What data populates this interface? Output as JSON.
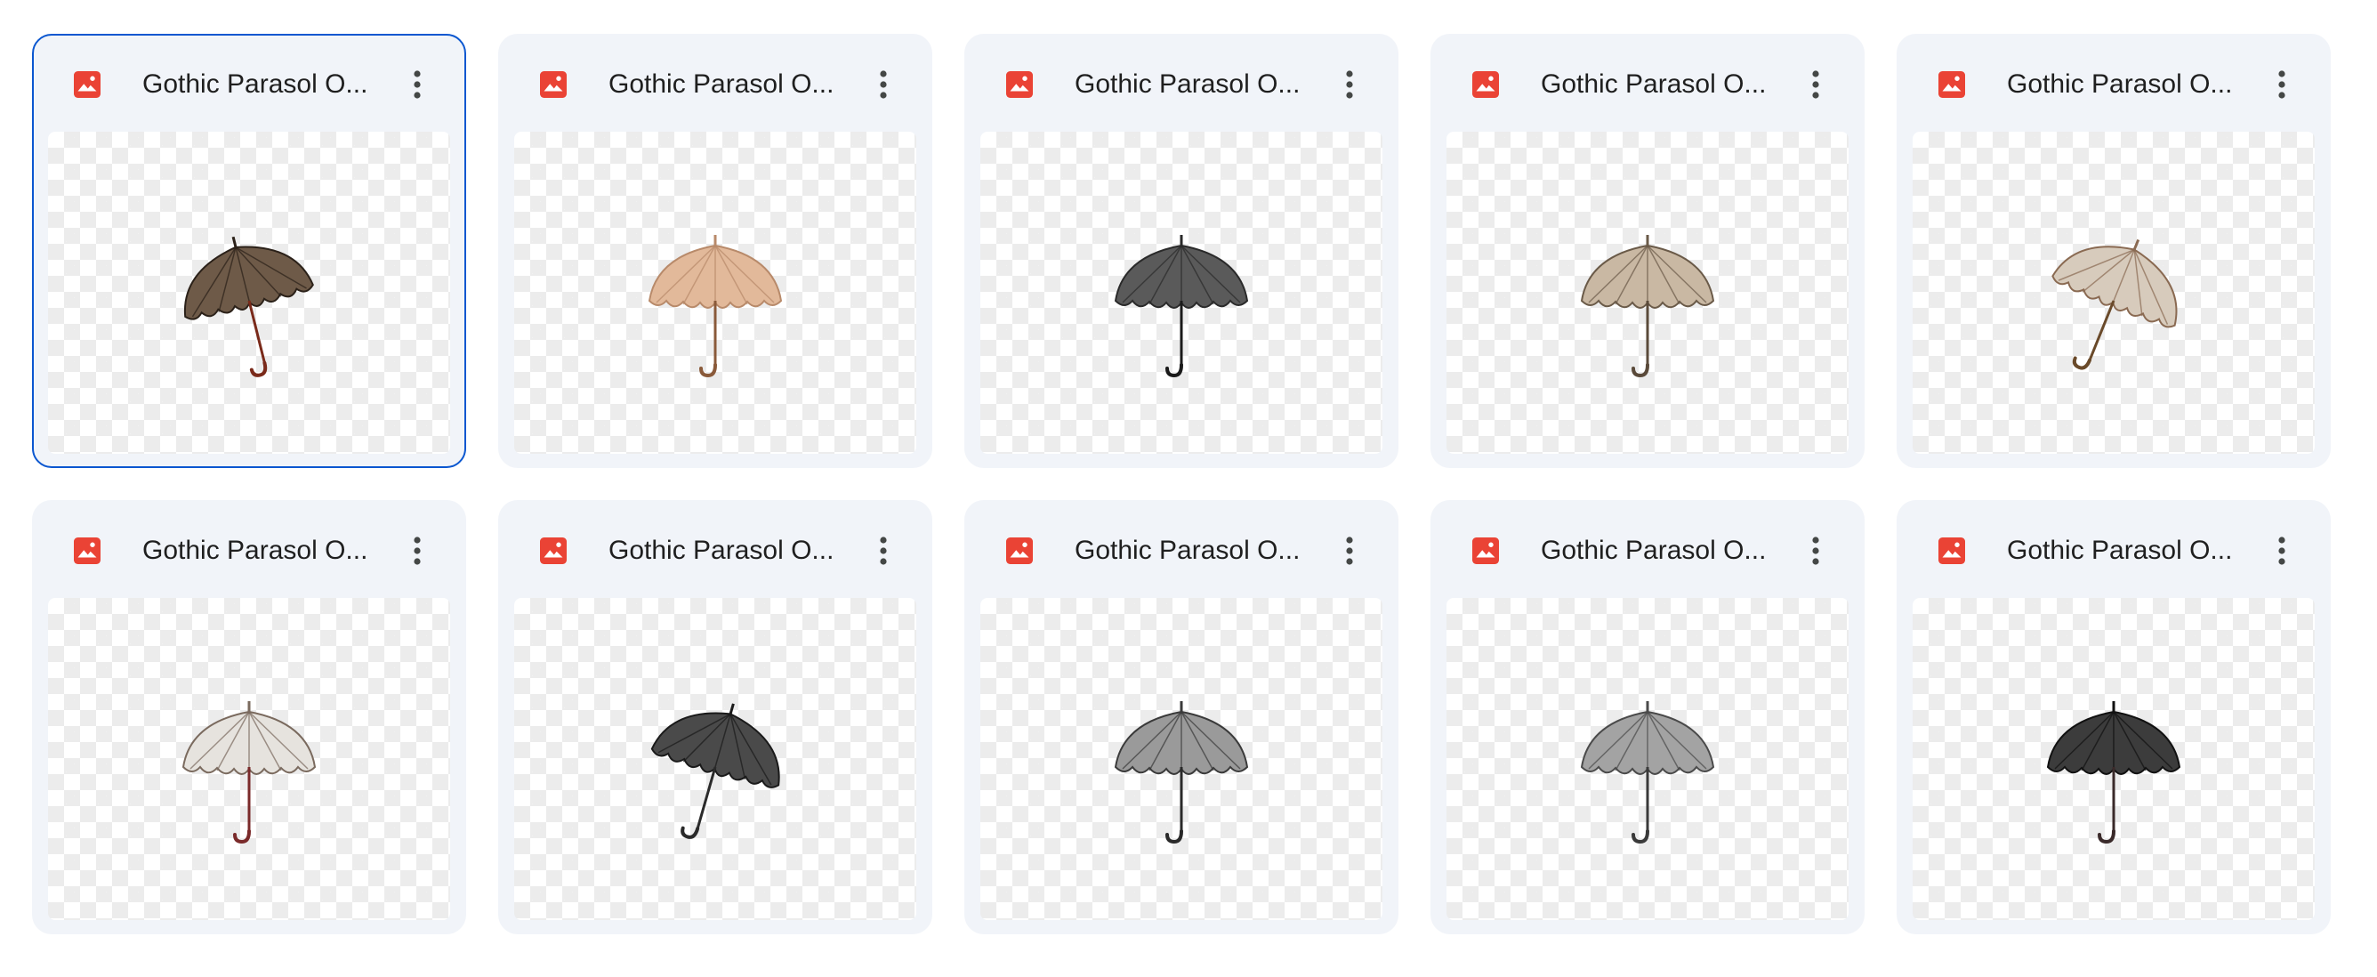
{
  "files": [
    {
      "title": "Gothic Parasol O...",
      "selected": true,
      "canopy": "#6e5a48",
      "accent": "#2b2119",
      "handle": "#7a2a1a",
      "tilt": -14
    },
    {
      "title": "Gothic Parasol O...",
      "selected": false,
      "canopy": "#e2b99a",
      "accent": "#b88a6a",
      "handle": "#8a5a3a",
      "tilt": 0
    },
    {
      "title": "Gothic Parasol O...",
      "selected": false,
      "canopy": "#5a5a5a",
      "accent": "#2a2a2a",
      "handle": "#1a1a1a",
      "tilt": 0
    },
    {
      "title": "Gothic Parasol O...",
      "selected": false,
      "canopy": "#c9b8a3",
      "accent": "#6a5a48",
      "handle": "#5a4a3a",
      "tilt": 0
    },
    {
      "title": "Gothic Parasol O...",
      "selected": false,
      "canopy": "#d7cbbc",
      "accent": "#8a6a52",
      "handle": "#6a4a2a",
      "tilt": 22
    },
    {
      "title": "Gothic Parasol O...",
      "selected": false,
      "canopy": "#e6e3de",
      "accent": "#7a6a5e",
      "handle": "#7a2a2a",
      "tilt": 0
    },
    {
      "title": "Gothic Parasol O...",
      "selected": false,
      "canopy": "#4a4a4a",
      "accent": "#1a1a1a",
      "handle": "#2a2a2a",
      "tilt": 16
    },
    {
      "title": "Gothic Parasol O...",
      "selected": false,
      "canopy": "#9a9a9a",
      "accent": "#3a3a3a",
      "handle": "#2a2a2a",
      "tilt": 0
    },
    {
      "title": "Gothic Parasol O...",
      "selected": false,
      "canopy": "#a3a3a3",
      "accent": "#4a4a4a",
      "handle": "#3a3a3a",
      "tilt": 0
    },
    {
      "title": "Gothic Parasol O...",
      "selected": false,
      "canopy": "#3c3c3c",
      "accent": "#111111",
      "handle": "#3a2a2a",
      "tilt": 0
    }
  ],
  "icons": {
    "file_type": "image-file-icon",
    "more": "more-vert-icon"
  },
  "colors": {
    "card_bg": "#f1f4f9",
    "selected_border": "#0b57d0",
    "image_icon": "#ea4335",
    "title_text": "#1f1f1f"
  }
}
